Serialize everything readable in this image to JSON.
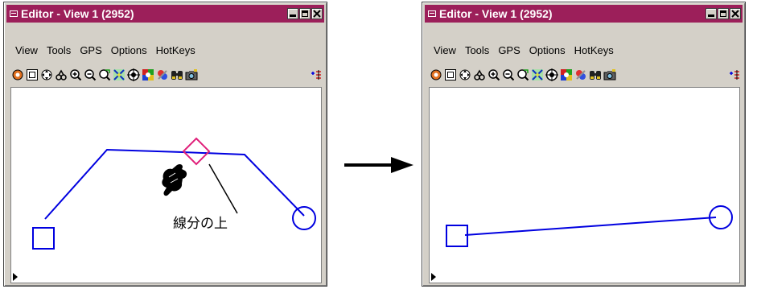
{
  "window": {
    "title": "Editor - View 1 (2952)"
  },
  "menu": [
    "View",
    "Tools",
    "GPS",
    "Options",
    "HotKeys"
  ],
  "toolbar": [
    "zoom-extents",
    "zoom-window",
    "pan",
    "fit",
    "zoom-in",
    "zoom-out",
    "zoom-previous",
    "zoom-selection",
    "snap",
    "layers",
    "colors",
    "find",
    "camera",
    "add-vertex"
  ],
  "annotation": {
    "label": "線分の上"
  },
  "colors": {
    "title_bar": "#9c1f5a",
    "line": "#0000e0",
    "highlight": "#e0207a"
  }
}
